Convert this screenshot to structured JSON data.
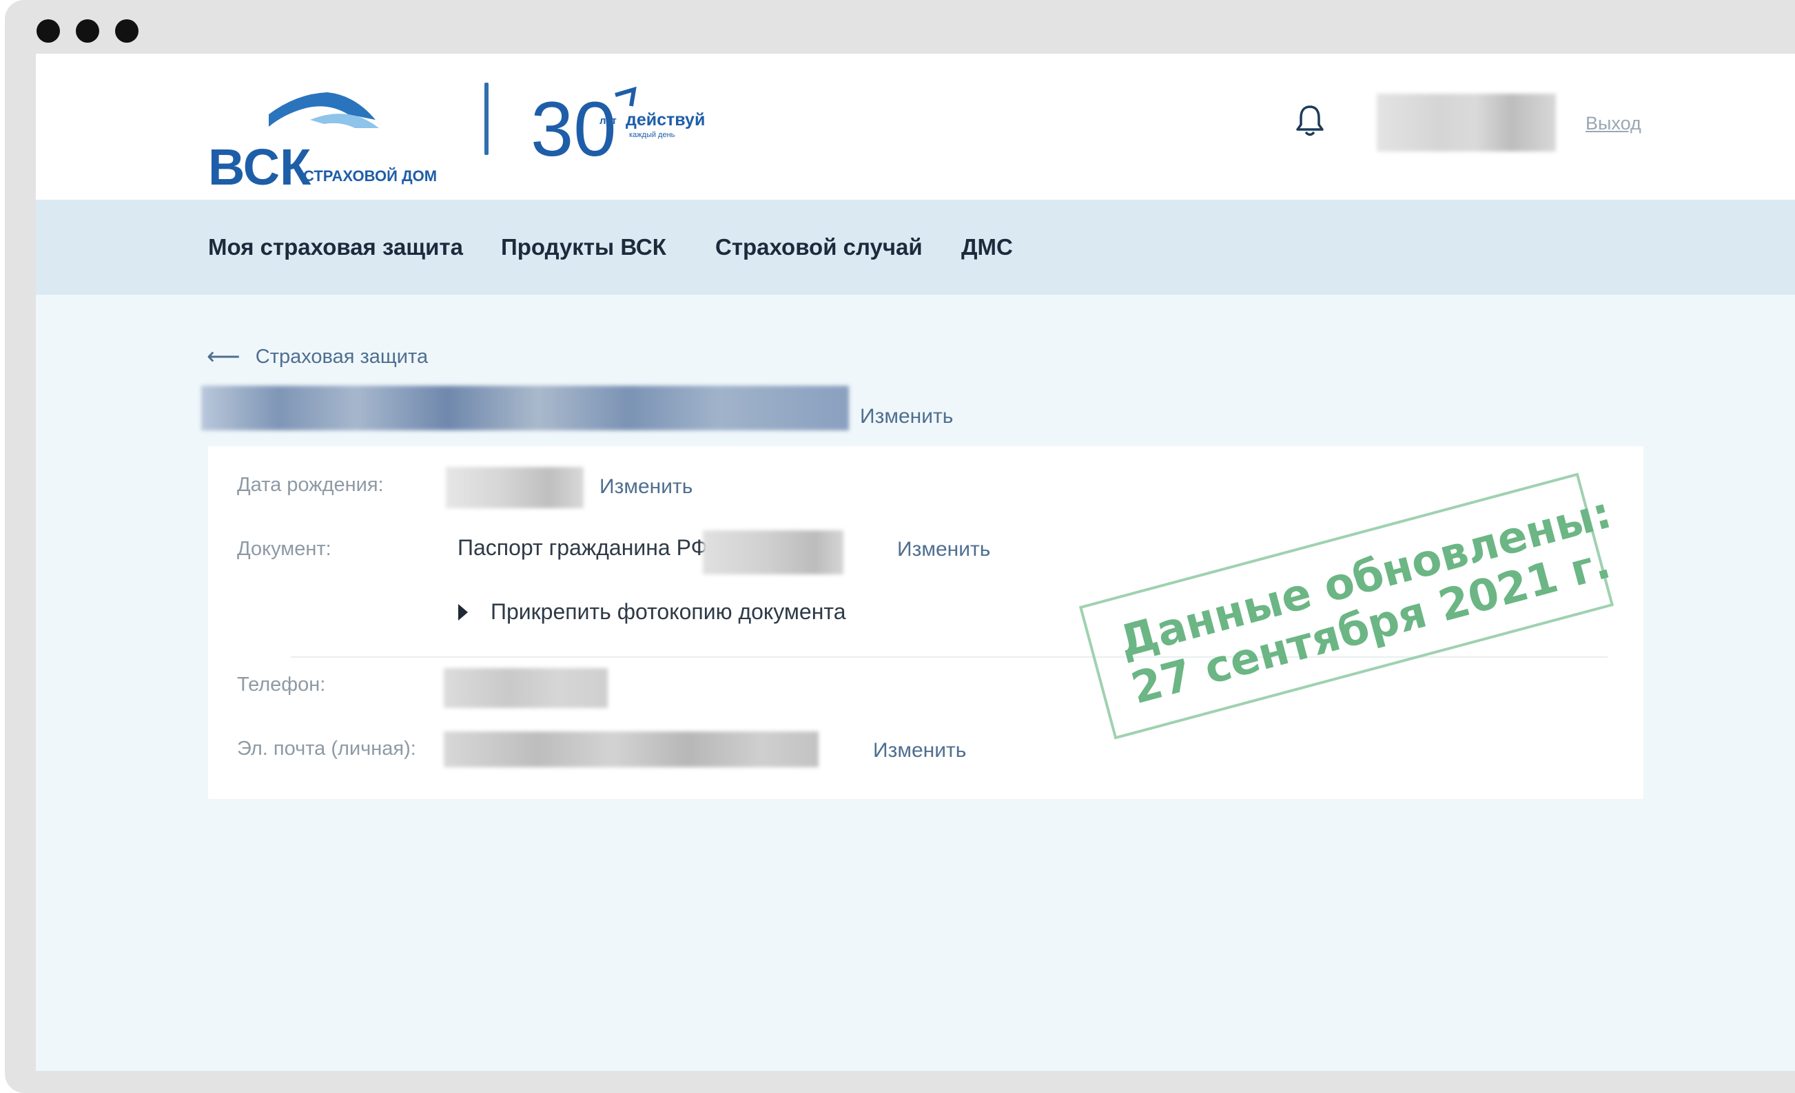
{
  "window": {
    "control_dots": [
      "close",
      "minimize",
      "maximize"
    ]
  },
  "header": {
    "logo": {
      "brand": "ВСК",
      "subtitle": "СТРАХОВОЙ ДОМ"
    },
    "anniversary": {
      "number": "30",
      "years": "лет",
      "motto": "действуй",
      "tagline": "каждый день"
    },
    "logout": "Выход",
    "icons": [
      "bell-icon"
    ]
  },
  "nav": {
    "items": [
      "Моя страховая защита",
      "Продукты ВСК",
      "Страховой случай",
      "ДМС"
    ]
  },
  "page": {
    "back_label": "Страховая защита",
    "name_edit": "Изменить"
  },
  "profile": {
    "birth_date_label": "Дата рождения:",
    "birth_date_edit": "Изменить",
    "document_label": "Документ:",
    "document_value": "Паспорт гражданина РФ:",
    "document_edit": "Изменить",
    "attach_label": "Прикрепить фотокопию документа",
    "phone_label": "Телефон:",
    "email_label": "Эл. почта (личная):",
    "email_edit": "Изменить"
  },
  "stamp": {
    "line1": "Данные обновлены:",
    "line2": "27 сентября 2021 г.",
    "color": "#52aa6f"
  },
  "colors": {
    "nav_bg": "#dbe9f3",
    "page_bg": "#f0f7fb",
    "brand_blue": "#1e5ea8",
    "link": "#4f6f90"
  }
}
